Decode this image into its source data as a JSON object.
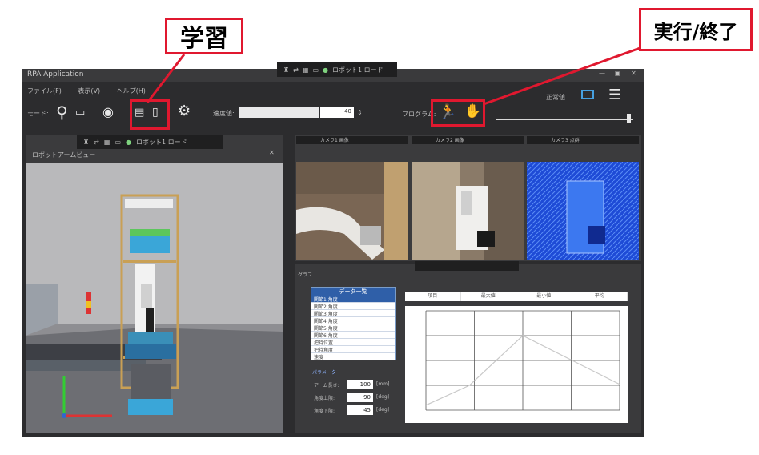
{
  "callouts": {
    "learn": "学習",
    "run_stop": "実行/終了"
  },
  "window": {
    "title": "RPA Application",
    "menu": [
      "ファイル(F)",
      "表示(V)",
      "ヘルプ(H)"
    ],
    "center_tab_label": "ロボット1 ロード"
  },
  "toolbar": {
    "mode_label": "モード:",
    "speed_label": "速度値:",
    "speed_value": "40",
    "run_label": "プログラム:",
    "status_label": "正常値",
    "run_slider_fraction": 0.97
  },
  "view3d": {
    "title": "ロボットアームビュー",
    "tab_label": "ロボット1 ロード"
  },
  "cameras": [
    {
      "label": "カメラ1 画像"
    },
    {
      "label": "カメラ2 画像"
    },
    {
      "label": "カメラ3 点群"
    }
  ],
  "graph_panel": {
    "title": "グラフ",
    "list_header": "データ一覧",
    "list_items": [
      "関節1 角度",
      "関節2 角度",
      "関節3 角度",
      "関節4 角度",
      "関節5 角度",
      "関節6 角度",
      "把持位置",
      "把持角度",
      "速度"
    ],
    "params_title": "パラメータ",
    "params": [
      {
        "label": "アーム長さ:",
        "value": "100",
        "unit": "[mm]"
      },
      {
        "label": "角度上限:",
        "value": "90",
        "unit": "[deg]"
      },
      {
        "label": "角度下限:",
        "value": "45",
        "unit": "[deg]"
      }
    ],
    "table_headers": [
      "項目",
      "最大値",
      "最小値",
      "平均"
    ],
    "colors": {
      "accent": "#2f5fa8",
      "callout": "#e0182f"
    }
  },
  "chart_data": {
    "type": "line",
    "x": [
      0,
      2.25,
      5,
      10
    ],
    "series": [
      {
        "values": [
          -4,
          0,
          10,
          0.2
        ]
      }
    ],
    "xlim": [
      0,
      10
    ],
    "ylim": [
      -5,
      15
    ],
    "grid": true
  }
}
